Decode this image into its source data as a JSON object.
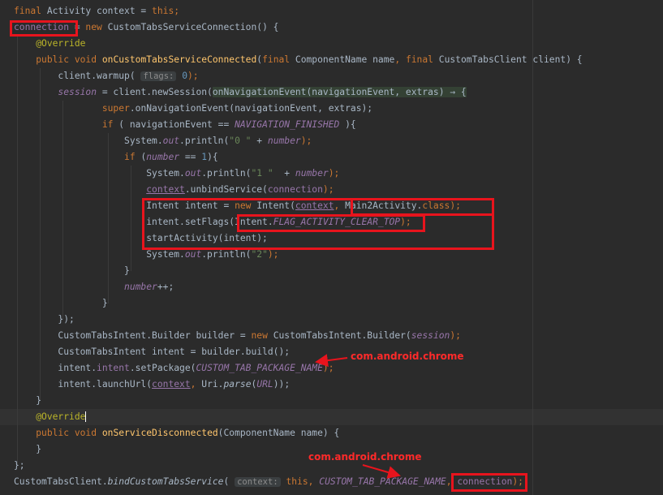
{
  "code": {
    "lines": [
      [
        {
          "t": "final ",
          "c": "k"
        },
        {
          "t": "Activity context = "
        },
        {
          "t": "this",
          "c": "k"
        },
        {
          "t": ";",
          "c": "k"
        }
      ],
      [
        {
          "t": "connection",
          "c": "v"
        },
        {
          "t": " = "
        },
        {
          "t": "new ",
          "c": "k"
        },
        {
          "t": "CustomTabsServiceConnection() {"
        }
      ],
      [
        {
          "t": "    "
        },
        {
          "t": "@Override",
          "c": "a"
        }
      ],
      [
        {
          "t": "    "
        },
        {
          "t": "public void ",
          "c": "k"
        },
        {
          "t": "onCustomTabsServiceConnected",
          "c": "f"
        },
        {
          "t": "("
        },
        {
          "t": "final ",
          "c": "k"
        },
        {
          "t": "ComponentName name"
        },
        {
          "t": ", ",
          "c": "k"
        },
        {
          "t": "final ",
          "c": "k"
        },
        {
          "t": "CustomTabsClient client) {"
        }
      ],
      [
        {
          "t": "        client.warmup( "
        },
        {
          "t": "flags:",
          "c": "hint"
        },
        {
          "t": " "
        },
        {
          "t": "0",
          "c": "n"
        },
        {
          "t": ");",
          "c": "k"
        }
      ],
      [
        {
          "t": "        "
        },
        {
          "t": "session",
          "c": "vi"
        },
        {
          "t": " = client.newSession("
        },
        {
          "t": "onNavigationEvent(navigationEvent, extras) → {",
          "c": "lm"
        }
      ],
      [
        {
          "t": "                "
        },
        {
          "t": "super",
          "c": "k"
        },
        {
          "t": ".onNavigationEvent(navigationEvent, extras);"
        }
      ],
      [
        {
          "t": "                "
        },
        {
          "t": "if ",
          "c": "k"
        },
        {
          "t": "( navigationEvent == "
        },
        {
          "t": "NAVIGATION_FINISHED",
          "c": "vi"
        },
        {
          "t": " ){"
        }
      ],
      [
        {
          "t": "                    System."
        },
        {
          "t": "out",
          "c": "vi"
        },
        {
          "t": ".println("
        },
        {
          "t": "\"0 \"",
          "c": "s"
        },
        {
          "t": " + "
        },
        {
          "t": "number",
          "c": "vi"
        },
        {
          "t": ");",
          "c": "k"
        }
      ],
      [
        {
          "t": "                    "
        },
        {
          "t": "if ",
          "c": "k"
        },
        {
          "t": "("
        },
        {
          "t": "number",
          "c": "vi"
        },
        {
          "t": " == "
        },
        {
          "t": "1",
          "c": "n"
        },
        {
          "t": "){"
        }
      ],
      [
        {
          "t": "                        System."
        },
        {
          "t": "out",
          "c": "vi"
        },
        {
          "t": ".println("
        },
        {
          "t": "\"1 \"",
          "c": "s"
        },
        {
          "t": "  + "
        },
        {
          "t": "number",
          "c": "vi"
        },
        {
          "t": ");",
          "c": "k"
        }
      ],
      [
        {
          "t": "                        "
        },
        {
          "t": "context",
          "c": "v u"
        },
        {
          "t": ".unbindService("
        },
        {
          "t": "connection",
          "c": "v"
        },
        {
          "t": ");",
          "c": "k"
        }
      ],
      [
        {
          "t": "                        Intent intent = "
        },
        {
          "t": "new ",
          "c": "k"
        },
        {
          "t": "Intent("
        },
        {
          "t": "context",
          "c": "v u"
        },
        {
          "t": ", ",
          "c": "k"
        },
        {
          "t": "Main2Activity."
        },
        {
          "t": "class",
          "c": "k"
        },
        {
          "t": ");",
          "c": "k"
        }
      ],
      [
        {
          "t": "                        intent.setFlags(Intent."
        },
        {
          "t": "FLAG_ACTIVITY_CLEAR_TOP",
          "c": "vi"
        },
        {
          "t": ");",
          "c": "k"
        }
      ],
      [
        {
          "t": "                        startActivity(intent);"
        }
      ],
      [
        {
          "t": "                        System."
        },
        {
          "t": "out",
          "c": "vi"
        },
        {
          "t": ".println("
        },
        {
          "t": "\"2\"",
          "c": "s"
        },
        {
          "t": ");",
          "c": "k"
        }
      ],
      [
        {
          "t": "                    }"
        }
      ],
      [
        {
          "t": "                    "
        },
        {
          "t": "number",
          "c": "vi"
        },
        {
          "t": "++;"
        }
      ],
      [
        {
          "t": "                }"
        }
      ],
      [
        {
          "t": "        });"
        }
      ],
      [
        {
          "t": "        CustomTabsIntent.Builder builder = "
        },
        {
          "t": "new ",
          "c": "k"
        },
        {
          "t": "CustomTabsIntent.Builder("
        },
        {
          "t": "session",
          "c": "vi"
        },
        {
          "t": ");",
          "c": "k"
        }
      ],
      [
        {
          "t": "        CustomTabsIntent intent = builder.build();"
        }
      ],
      [
        {
          "t": "        intent."
        },
        {
          "t": "intent",
          "c": "v"
        },
        {
          "t": ".setPackage("
        },
        {
          "t": "CUSTOM_TAB_PACKAGE_NAME",
          "c": "vi"
        },
        {
          "t": ");",
          "c": "k"
        }
      ],
      [
        {
          "t": "        intent.launchUrl("
        },
        {
          "t": "context",
          "c": "v u"
        },
        {
          "t": ", ",
          "c": "k"
        },
        {
          "t": "Uri."
        },
        {
          "t": "parse",
          "c": "it"
        },
        {
          "t": "("
        },
        {
          "t": "URL",
          "c": "vi"
        },
        {
          "t": "));"
        }
      ],
      [
        {
          "t": "    }"
        }
      ],
      [
        {
          "t": "    "
        },
        {
          "t": "@Override",
          "c": "a cur"
        }
      ],
      [
        {
          "t": "    "
        },
        {
          "t": "public void ",
          "c": "k"
        },
        {
          "t": "onServiceDisconnected",
          "c": "f"
        },
        {
          "t": "(ComponentName name) {"
        }
      ],
      [
        {
          "t": "    }"
        }
      ],
      [
        {
          "t": "};"
        }
      ],
      [
        {
          "t": "CustomTabsClient."
        },
        {
          "t": "bindCustomTabsService",
          "c": "it"
        },
        {
          "t": "( "
        },
        {
          "t": "context:",
          "c": "hint"
        },
        {
          "t": " "
        },
        {
          "t": "this",
          "c": "k"
        },
        {
          "t": ", ",
          "c": "k"
        },
        {
          "t": "CUSTOM_TAB_PACKAGE_NAME",
          "c": "vi"
        },
        {
          "t": ", ",
          "c": "k"
        },
        {
          "t": "connection",
          "c": "v"
        },
        {
          "t": ");",
          "c": "k"
        }
      ]
    ]
  },
  "annotations": {
    "label_1": "com.android.chrome",
    "label_2": "com.android.chrome"
  },
  "colors": {
    "background": "#2b2b2b",
    "highlight_box": "#e8141d",
    "annotation_text": "#ff2a2a",
    "keyword": "#cc7832",
    "string": "#6a8759",
    "number": "#6897bb",
    "field": "#9876aa",
    "method_decl": "#ffc66d",
    "annotation": "#bbb529"
  }
}
